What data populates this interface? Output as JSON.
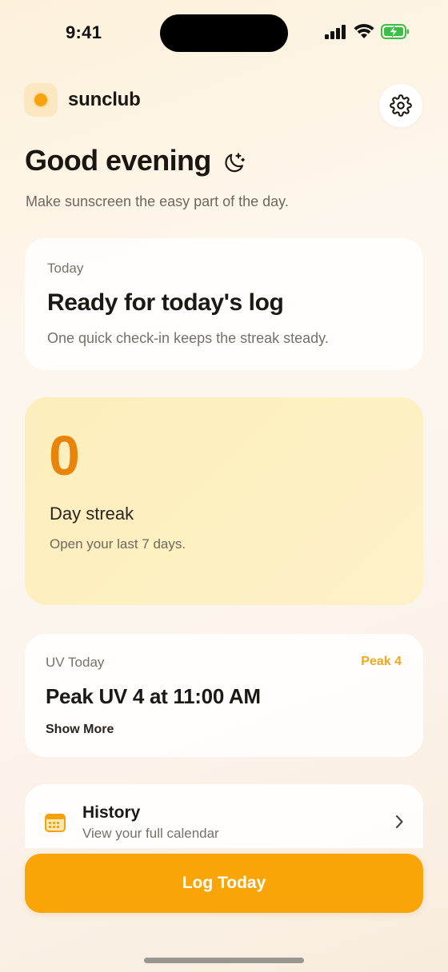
{
  "status_bar": {
    "time": "9:41"
  },
  "brand": {
    "name": "sunclub"
  },
  "greeting": {
    "text": "Good evening",
    "subtitle": "Make sunscreen the easy part of the day."
  },
  "today_card": {
    "label": "Today",
    "title": "Ready for today's log",
    "subtitle": "One quick check-in keeps the streak steady."
  },
  "streak_card": {
    "count": "0",
    "label": "Day streak",
    "subtitle": "Open your last 7 days."
  },
  "uv_card": {
    "label": "UV Today",
    "badge": "Peak 4",
    "title": "Peak UV 4 at 11:00 AM",
    "show_more": "Show More"
  },
  "history_card": {
    "title": "History",
    "subtitle": "View your full calendar"
  },
  "log_button": {
    "label": "Log Today"
  },
  "icons": {
    "settings": "gear-icon",
    "greeting": "moon-stars-icon",
    "history": "calendar-icon",
    "chevron": "chevron-right-icon"
  },
  "colors": {
    "accent": "#f9a507",
    "streak_number": "#e8840a",
    "uv_badge": "#f0a820",
    "streak_bg": "#fdeebd"
  }
}
